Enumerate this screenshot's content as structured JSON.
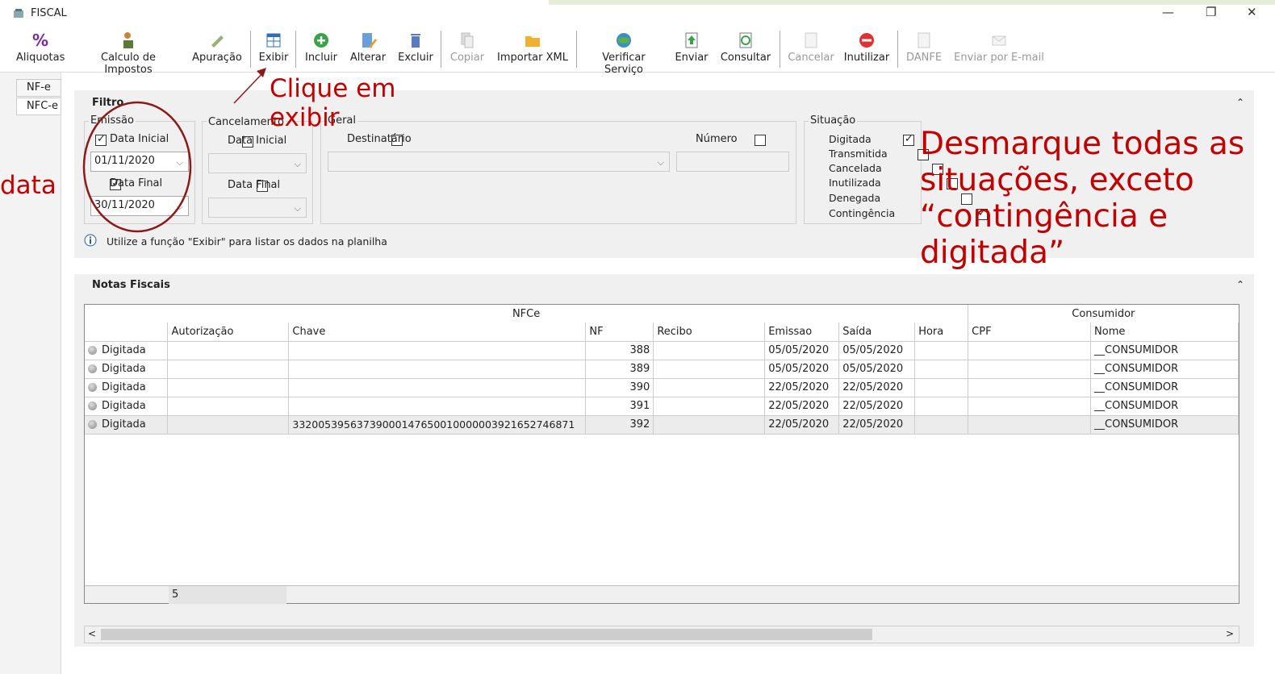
{
  "window": {
    "title": "FISCAL"
  },
  "toolbar": {
    "items": [
      {
        "label": "Aliquotas",
        "icon": "percent-icon",
        "enabled": true
      },
      {
        "label": "Calculo de Impostos",
        "icon": "calculator-person-icon",
        "enabled": true
      },
      {
        "label": "Apuração",
        "icon": "stamp-icon",
        "enabled": true
      },
      {
        "label": "Exibir",
        "icon": "grid-icon",
        "enabled": true
      },
      {
        "label": "Incluir",
        "icon": "plus-circle-icon",
        "enabled": true
      },
      {
        "label": "Alterar",
        "icon": "edit-doc-icon",
        "enabled": true
      },
      {
        "label": "Excluir",
        "icon": "trash-icon",
        "enabled": true
      },
      {
        "label": "Copiar",
        "icon": "copy-icon",
        "enabled": false
      },
      {
        "label": "Importar XML",
        "icon": "folder-icon",
        "enabled": true
      },
      {
        "label": "Verificar Serviço",
        "icon": "globe-icon",
        "enabled": true
      },
      {
        "label": "Enviar",
        "icon": "upload-doc-icon",
        "enabled": true
      },
      {
        "label": "Consultar",
        "icon": "refresh-doc-icon",
        "enabled": true
      },
      {
        "label": "Cancelar",
        "icon": "cancel-doc-icon",
        "enabled": false
      },
      {
        "label": "Inutilizar",
        "icon": "stop-icon",
        "enabled": true
      },
      {
        "label": "DANFE",
        "icon": "danfe-icon",
        "enabled": false
      },
      {
        "label": "Enviar por E-mail",
        "icon": "email-icon",
        "enabled": false
      }
    ]
  },
  "sidebar": {
    "tabs": [
      "NF-e",
      "NFC-e"
    ]
  },
  "filtro": {
    "title": "Filtro",
    "emissao": {
      "legend": "Emissão",
      "data_inicial_label": "Data Inicial",
      "data_inicial": "01/11/2020",
      "data_final_label": "Data Final",
      "data_final": "30/11/2020"
    },
    "cancelamento": {
      "legend": "Cancelamento",
      "data_inicial_label": "Data Inicial",
      "data_final_label": "Data Final"
    },
    "geral": {
      "legend": "Geral",
      "destinatario_label": "Destinatário",
      "numero_label": "Número"
    },
    "situacao": {
      "legend": "Situação",
      "items": [
        {
          "label": "Digitada",
          "checked": true
        },
        {
          "label": "Transmitida",
          "checked": false
        },
        {
          "label": "Cancelada",
          "checked": false
        },
        {
          "label": "Inutilizada",
          "checked": false
        },
        {
          "label": "Denegada",
          "checked": false
        },
        {
          "label": "Contingência",
          "checked": true
        }
      ]
    },
    "info": "Utilize a função \"Exibir\" para listar os dados na planilha"
  },
  "notas": {
    "title": "Notas Fiscais",
    "group_nfce": "NFCe",
    "group_consumidor": "Consumidor",
    "columns": [
      "",
      "Autorização",
      "Chave",
      "NF",
      "Recibo",
      "Emissao",
      "Saída",
      "Hora",
      "CPF",
      "Nome"
    ],
    "rows": [
      {
        "status": "Digitada",
        "autorizacao": "",
        "chave": "",
        "nf": "388",
        "recibo": "",
        "emissao": "05/05/2020",
        "saida": "05/05/2020",
        "hora": "",
        "cpf": "",
        "nome": "__CONSUMIDOR"
      },
      {
        "status": "Digitada",
        "autorizacao": "",
        "chave": "",
        "nf": "389",
        "recibo": "",
        "emissao": "05/05/2020",
        "saida": "05/05/2020",
        "hora": "",
        "cpf": "",
        "nome": "__CONSUMIDOR"
      },
      {
        "status": "Digitada",
        "autorizacao": "",
        "chave": "",
        "nf": "390",
        "recibo": "",
        "emissao": "22/05/2020",
        "saida": "22/05/2020",
        "hora": "",
        "cpf": "",
        "nome": "__CONSUMIDOR"
      },
      {
        "status": "Digitada",
        "autorizacao": "",
        "chave": "",
        "nf": "391",
        "recibo": "",
        "emissao": "22/05/2020",
        "saida": "22/05/2020",
        "hora": "",
        "cpf": "",
        "nome": "__CONSUMIDOR"
      },
      {
        "status": "Digitada",
        "autorizacao": "",
        "chave": "33200539563739000147650010000003921652746871",
        "nf": "392",
        "recibo": "",
        "emissao": "22/05/2020",
        "saida": "22/05/2020",
        "hora": "",
        "cpf": "",
        "nome": "__CONSUMIDOR"
      }
    ],
    "footer_count": "5"
  },
  "annotations": {
    "clique": "Clique em exibir",
    "data": "data",
    "desmarque": "Desmarque todas as situações, exceto “contingência e digitada”"
  },
  "colors": {
    "annotation": "#c00000"
  }
}
